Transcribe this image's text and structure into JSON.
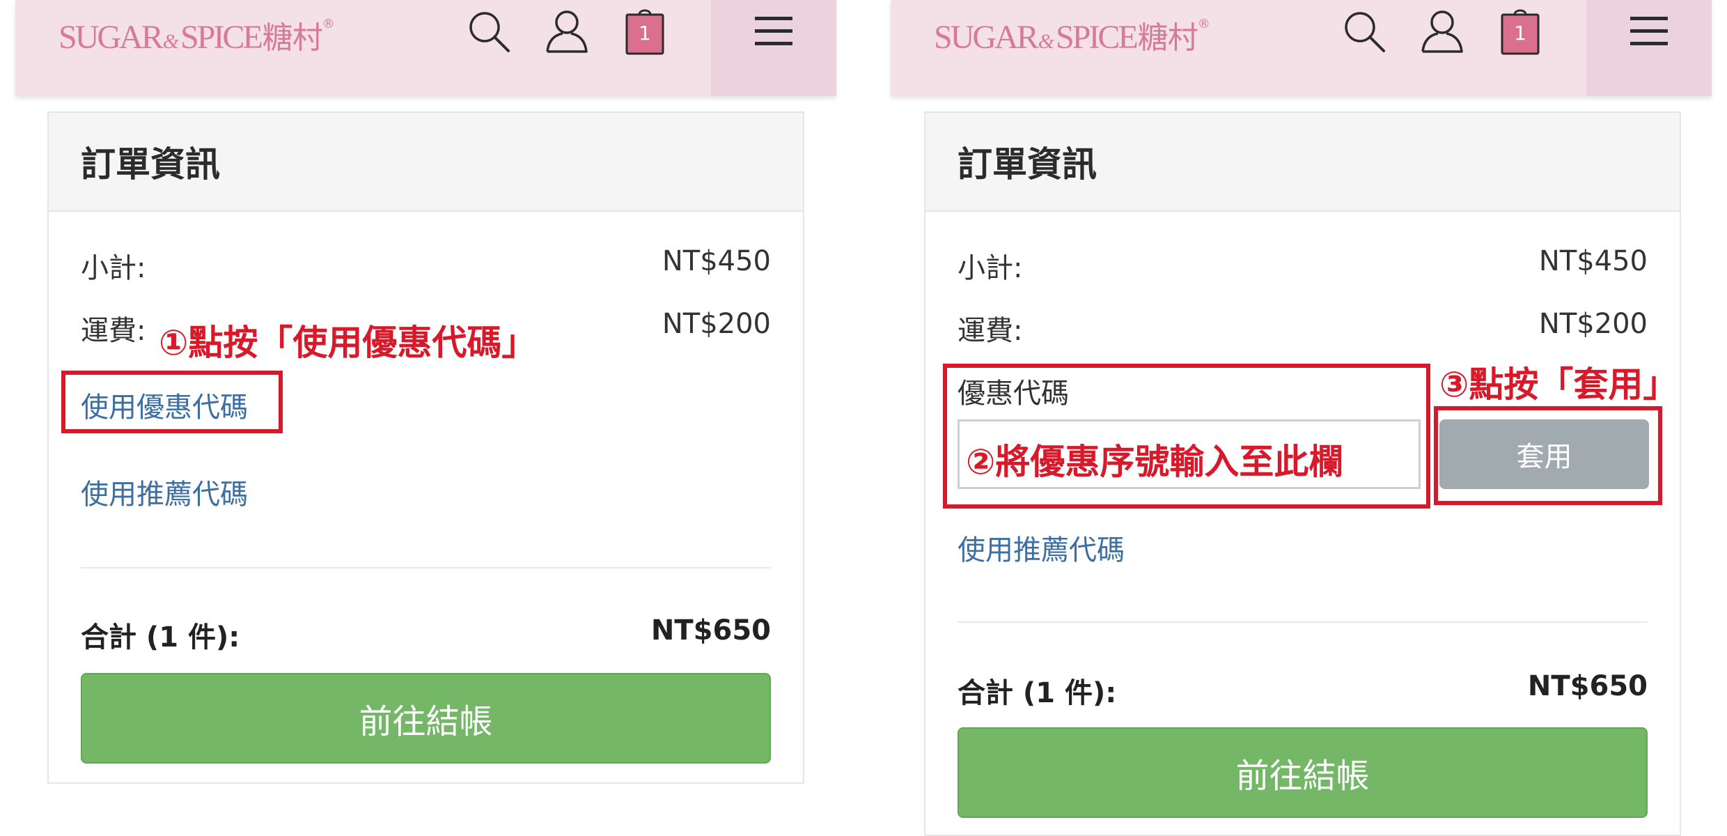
{
  "brand": {
    "sugar": "SUGAR",
    "amp": "&",
    "spice": "SPICE",
    "cn": "糖村",
    "reg": "®"
  },
  "header": {
    "cart_count": "1"
  },
  "left": {
    "title": "訂單資訊",
    "subtotal_label": "小計:",
    "subtotal_value": "NT$450",
    "shipping_label": "運費:",
    "shipping_value": "NT$200",
    "coupon_link": "使用優惠代碼",
    "referral_link": "使用推薦代碼",
    "total_label": "合計 (1 件):",
    "total_value": "NT$650",
    "checkout_label": "前往結帳",
    "note1": "①點按「使用優惠代碼」"
  },
  "right": {
    "title": "訂單資訊",
    "subtotal_label": "小計:",
    "subtotal_value": "NT$450",
    "shipping_label": "運費:",
    "shipping_value": "NT$200",
    "coupon_label": "優惠代碼",
    "apply_label": "套用",
    "referral_link": "使用推薦代碼",
    "total_label": "合計 (1 件):",
    "total_value": "NT$650",
    "checkout_label": "前往結帳",
    "note2": "②將優惠序號輸入至此欄",
    "note3": "③點按「套用」"
  },
  "colors": {
    "header_bg": "#f3e1e7",
    "brand_pink": "#d77a98",
    "link_blue": "#3c6ea2",
    "checkout_green": "#73b767",
    "apply_gray": "#a1aaae",
    "annotation_red": "#d7192a"
  },
  "icons": [
    "search-icon",
    "user-icon",
    "cart-icon",
    "menu-icon"
  ]
}
